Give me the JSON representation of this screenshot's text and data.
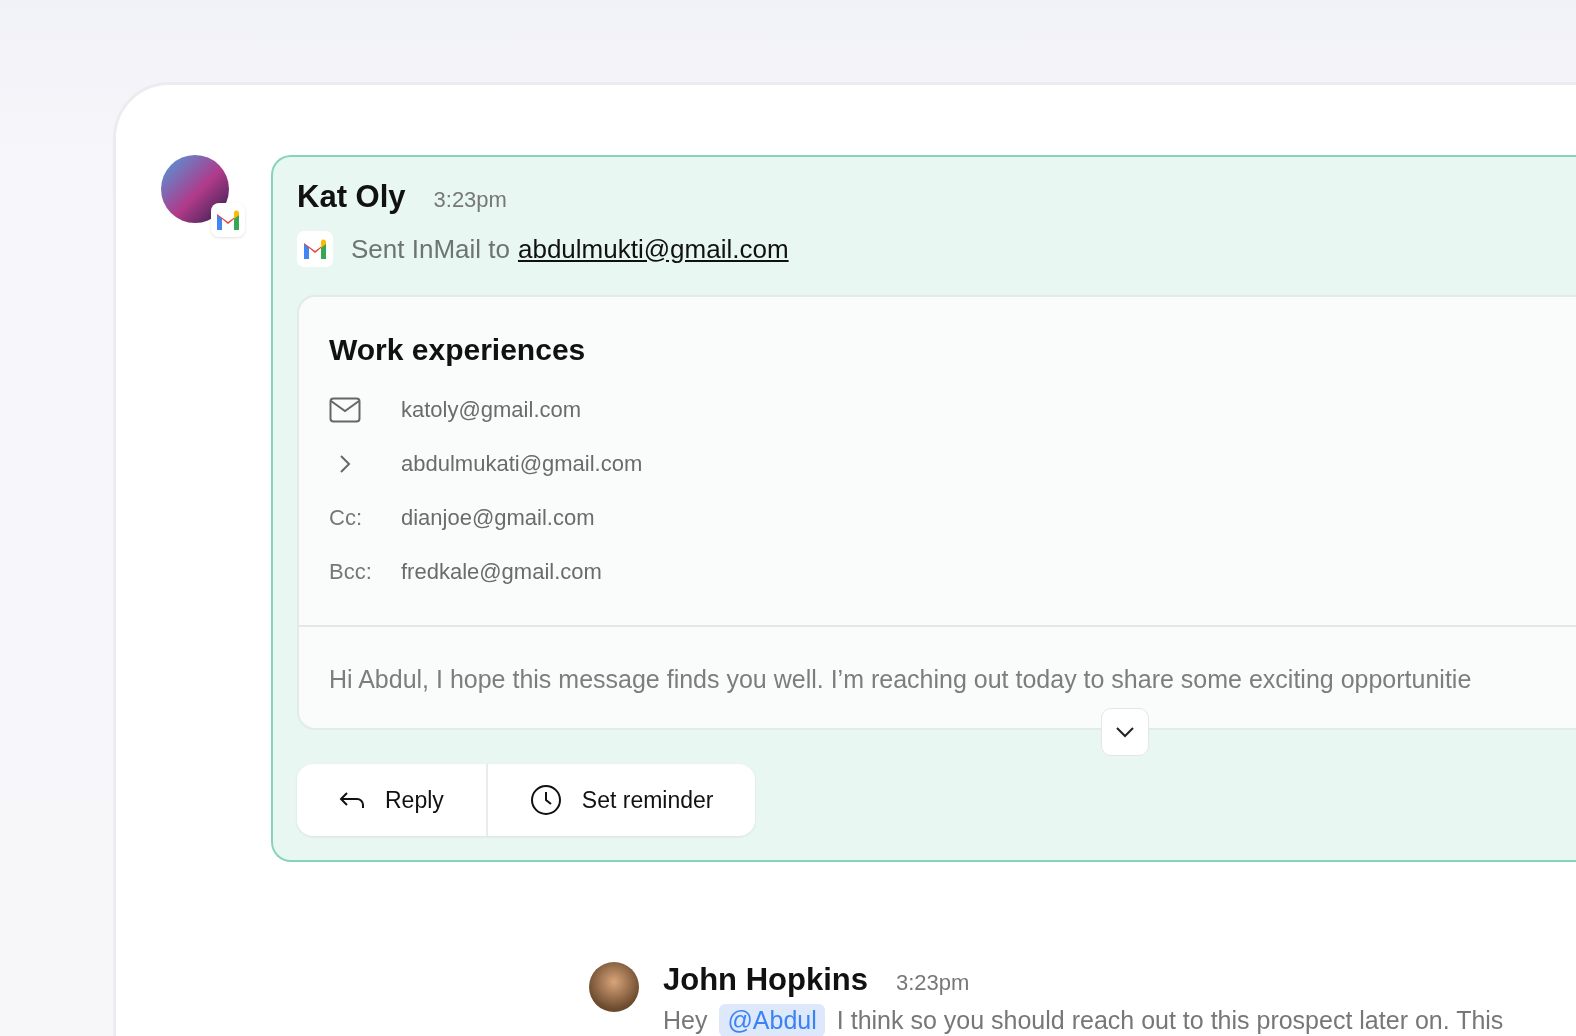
{
  "message": {
    "sender": "Kat Oly",
    "time": "3:23pm",
    "action": "Sent InMail to",
    "recipient": "abdulmukti@gmail.com",
    "email": {
      "title": "Work experiences",
      "fields": [
        {
          "kind": "mail",
          "value": "katoly@gmail.com"
        },
        {
          "kind": "forward",
          "value": "abdulmukati@gmail.com"
        },
        {
          "kind": "label",
          "label": "Cc:",
          "value": "dianjoe@gmail.com"
        },
        {
          "kind": "label",
          "label": "Bcc:",
          "value": "fredkale@gmail.com"
        }
      ],
      "body": "Hi Abdul, I hope this message finds you well. I’m reaching out today to share some exciting opportunitie"
    },
    "actions": [
      {
        "kind": "reply",
        "label": "Reply"
      },
      {
        "kind": "reminder",
        "label": "Set reminder"
      }
    ]
  },
  "comment": {
    "sender": "John Hopkins",
    "time": "3:23pm",
    "greeting": "Hey",
    "mention": "@Abdul",
    "text": "I think so you should reach out to this prospect later on. This"
  }
}
